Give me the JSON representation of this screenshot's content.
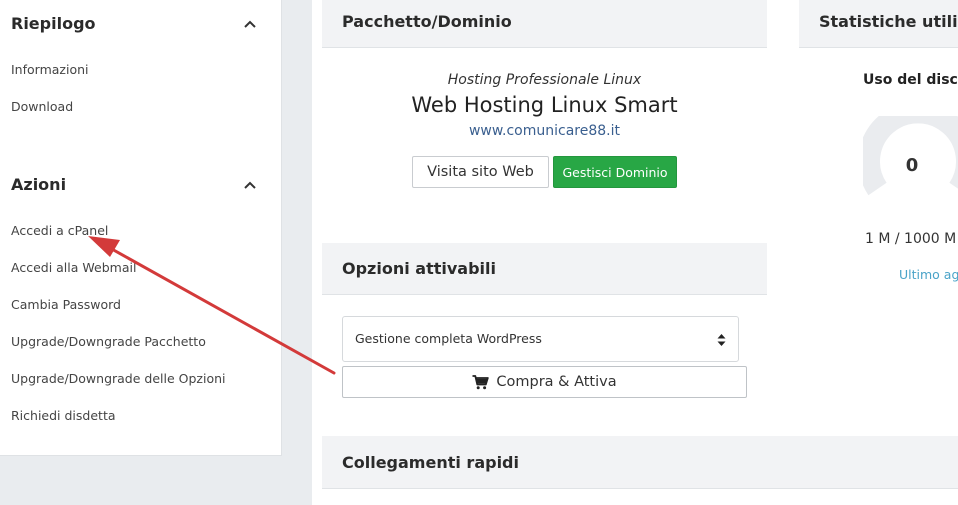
{
  "sidebar": {
    "summary": {
      "title": "Riepilogo",
      "items": [
        "Informazioni",
        "Download"
      ]
    },
    "actions": {
      "title": "Azioni",
      "items": [
        "Accedi a cPanel",
        "Accedi alla Webmail",
        "Cambia Password",
        "Upgrade/Downgrade Pacchetto",
        "Upgrade/Downgrade delle Opzioni",
        "Richiedi disdetta"
      ]
    }
  },
  "package": {
    "title": "Pacchetto/Dominio",
    "group": "Hosting Professionale Linux",
    "name": "Web Hosting Linux Smart",
    "domain": "www.comunicare88.it",
    "visit_label": "Visita sito Web",
    "manage_label": "Gestisci Dominio"
  },
  "options": {
    "title": "Opzioni attivabili",
    "selected": "Gestione completa WordPress",
    "buy_label": "Compra & Attiva"
  },
  "quicklinks": {
    "title": "Collegamenti rapidi"
  },
  "stats": {
    "title": "Statistiche utilizz",
    "disk_label": "Uso del disco",
    "gauge_value": "0",
    "usage_text": "1 M / 1000 M",
    "updated_text": "Ultimo agg"
  },
  "colors": {
    "accent_green": "#28a745",
    "link_blue": "#3a5f8f",
    "annotation_red": "#d33a3a"
  },
  "icons": {
    "chevron": "chevron-up-icon",
    "cart": "shopping-cart-icon",
    "select_arrows": "sort-arrows-icon"
  }
}
